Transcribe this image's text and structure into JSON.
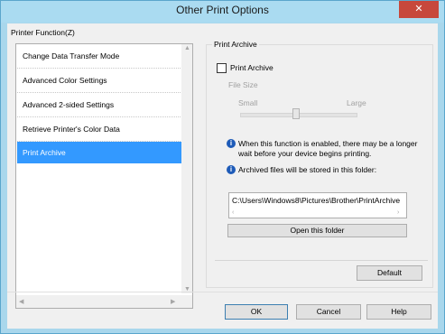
{
  "window": {
    "title": "Other Print Options",
    "close_glyph": "✕"
  },
  "printer_function": {
    "label": "Printer Function(Z)",
    "items": [
      {
        "label": "Change Data Transfer Mode",
        "selected": false
      },
      {
        "label": "Advanced Color Settings",
        "selected": false
      },
      {
        "label": "Advanced 2-sided Settings",
        "selected": false
      },
      {
        "label": "Retrieve Printer's Color Data",
        "selected": false
      },
      {
        "label": "Print Archive",
        "selected": true
      }
    ]
  },
  "print_archive": {
    "group_title": "Print Archive",
    "checkbox_label": "Print Archive",
    "checked": false,
    "file_size_label": "File Size",
    "slider_min_label": "Small",
    "slider_max_label": "Large",
    "info_1": "When this function is enabled, there may be a longer wait before your device begins printing.",
    "info_2": "Archived files will be stored in this folder:",
    "folder_path": "C:\\Users\\Windows8\\Pictures\\Brother\\PrintArchive",
    "open_folder_label": "Open this folder",
    "default_label": "Default"
  },
  "footer": {
    "ok_label": "OK",
    "cancel_label": "Cancel",
    "help_label": "Help"
  },
  "colors": {
    "title_bar": "#aadbf1",
    "selection": "#3399ff",
    "close_button": "#c7483c",
    "info_icon": "#1e5bb8"
  }
}
